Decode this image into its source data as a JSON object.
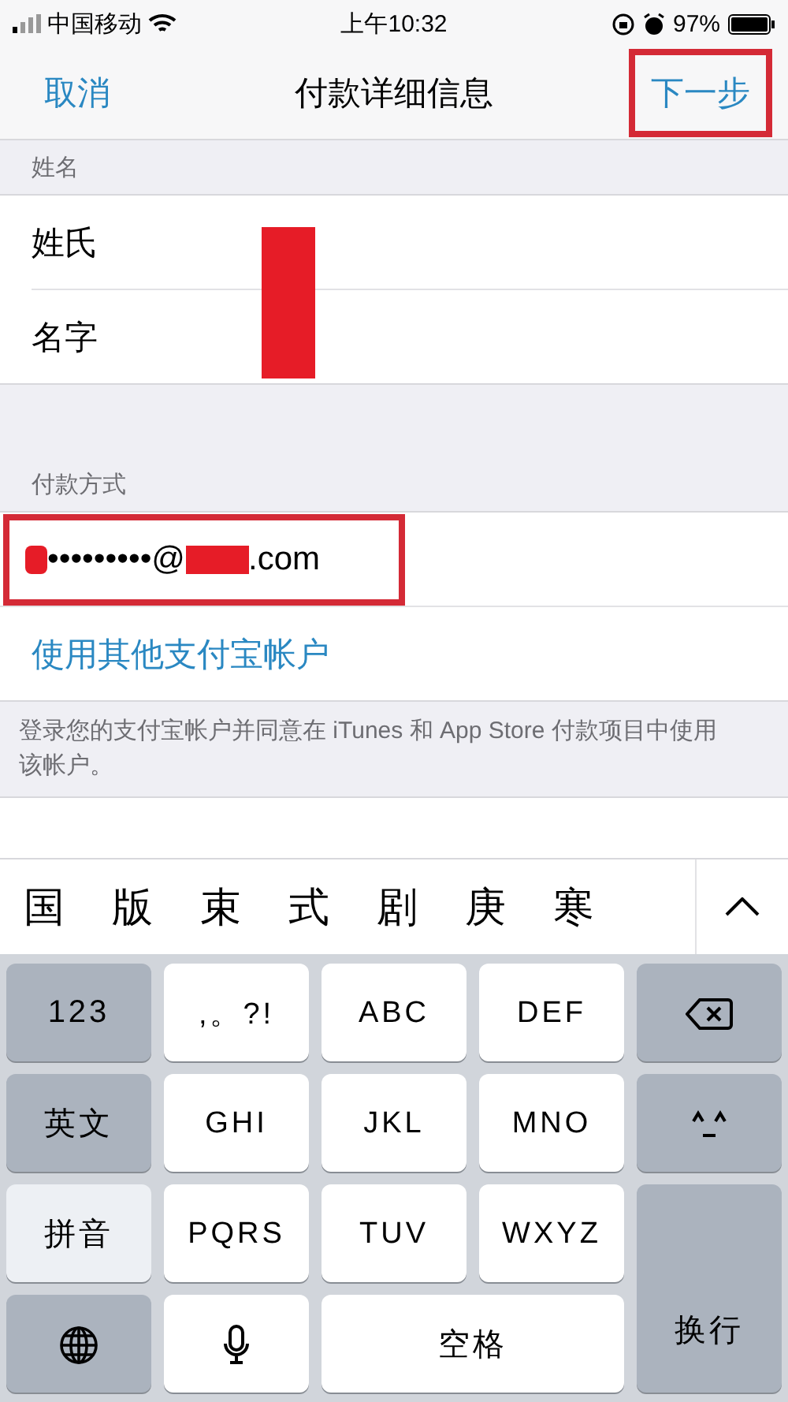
{
  "status_bar": {
    "carrier": "中国移动",
    "time": "上午10:32",
    "battery": "97%"
  },
  "nav": {
    "cancel": "取消",
    "title": "付款详细信息",
    "next": {
      "label": "下一步",
      "highlighted": true
    }
  },
  "name_section": {
    "header": "姓名",
    "fields": [
      {
        "label": "姓氏"
      },
      {
        "label": "名字"
      }
    ],
    "redacted": true
  },
  "payment_section": {
    "header": "付款方式",
    "account": {
      "masked": "•••••••••@",
      "domain": ".com",
      "highlighted": true
    },
    "link": "使用其他支付宝帐户",
    "note": "登录您的支付宝帐户并同意在 iTunes 和 App Store 付款项目中使用该帐户。"
  },
  "candidates": [
    "国",
    "版",
    "束",
    "式",
    "剧",
    "庚",
    "寒"
  ],
  "keyboard": [
    {
      "kind": "function",
      "label": "123",
      "selected": false
    },
    {
      "kind": "letter",
      "label": ",。?!",
      "selected": false
    },
    {
      "kind": "letter",
      "label": "ABC",
      "selected": false
    },
    {
      "kind": "letter",
      "label": "DEF",
      "selected": false
    },
    {
      "kind": "delete",
      "selected": false
    },
    {
      "kind": "function",
      "label": "英文",
      "selected": false
    },
    {
      "kind": "letter",
      "label": "GHI",
      "selected": false
    },
    {
      "kind": "letter",
      "label": "JKL",
      "selected": false
    },
    {
      "kind": "letter",
      "label": "MNO",
      "selected": false
    },
    {
      "kind": "emoji",
      "selected": false
    },
    {
      "kind": "function",
      "label": "拼音",
      "selected": true
    },
    {
      "kind": "letter",
      "label": "PQRS",
      "selected": false
    },
    {
      "kind": "letter",
      "label": "TUV",
      "selected": false
    },
    {
      "kind": "letter",
      "label": "WXYZ",
      "selected": false
    },
    {
      "kind": "return",
      "label": "换行",
      "selected": false
    },
    {
      "kind": "globe",
      "selected": false
    },
    {
      "kind": "mic",
      "selected": false
    },
    {
      "kind": "space",
      "label": "空格",
      "selected": false
    }
  ]
}
